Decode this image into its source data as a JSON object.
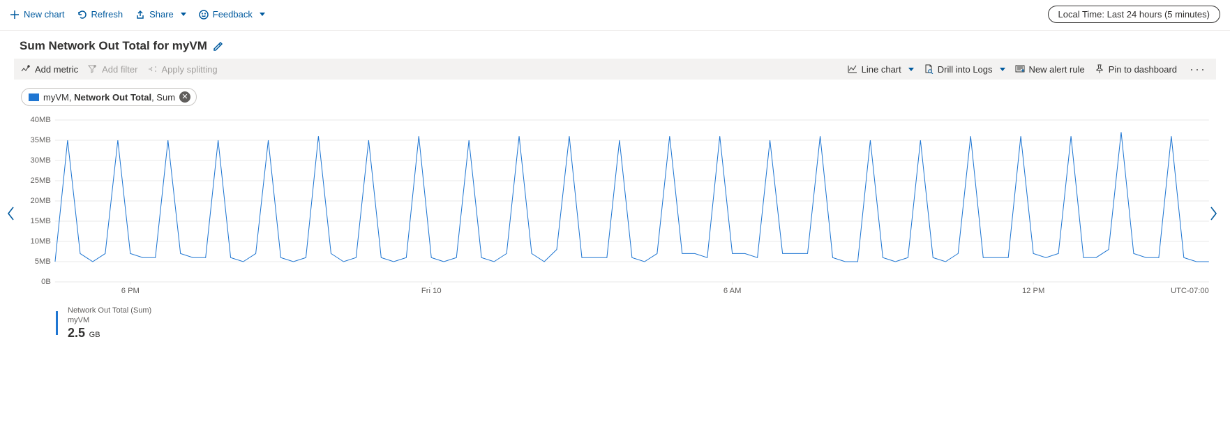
{
  "header": {
    "new_chart": "New chart",
    "refresh": "Refresh",
    "share": "Share",
    "feedback": "Feedback",
    "time_range": "Local Time: Last 24 hours (5 minutes)"
  },
  "title": "Sum Network Out Total for myVM",
  "sub_toolbar": {
    "add_metric": "Add metric",
    "add_filter": "Add filter",
    "apply_splitting": "Apply splitting",
    "line_chart": "Line chart",
    "drill_logs": "Drill into Logs",
    "new_alert": "New alert rule",
    "pin": "Pin to dashboard"
  },
  "chip": {
    "resource": "myVM",
    "metric": "Network Out Total",
    "agg": "Sum"
  },
  "legend": {
    "series_label": "Network Out Total (Sum)",
    "resource_label": "myVM",
    "value": "2.5",
    "unit": "GB"
  },
  "chart_data": {
    "type": "line",
    "title": "Sum Network Out Total for myVM",
    "ylabel": "",
    "xlabel": "",
    "ylim": [
      0,
      40
    ],
    "y_unit": "MB",
    "y_ticks": [
      0,
      5,
      10,
      15,
      20,
      25,
      30,
      35,
      40
    ],
    "y_tick_labels": [
      "0B",
      "5MB",
      "10MB",
      "15MB",
      "20MB",
      "25MB",
      "30MB",
      "35MB",
      "40MB"
    ],
    "x_ticks_idx": [
      6,
      30,
      54,
      78
    ],
    "x_tick_labels": [
      "6 PM",
      "Fri 10",
      "6 AM",
      "12 PM"
    ],
    "tz_label": "UTC-07:00",
    "series": [
      {
        "name": "Network Out Total (Sum)",
        "values": [
          5,
          35,
          7,
          5,
          7,
          35,
          7,
          6,
          6,
          35,
          7,
          6,
          6,
          35,
          6,
          5,
          7,
          35,
          6,
          5,
          6,
          36,
          7,
          5,
          6,
          35,
          6,
          5,
          6,
          36,
          6,
          5,
          6,
          35,
          6,
          5,
          7,
          36,
          7,
          5,
          8,
          36,
          6,
          6,
          6,
          35,
          6,
          5,
          7,
          36,
          7,
          7,
          6,
          36,
          7,
          7,
          6,
          35,
          7,
          7,
          7,
          36,
          6,
          5,
          5,
          35,
          6,
          5,
          6,
          35,
          6,
          5,
          7,
          36,
          6,
          6,
          6,
          36,
          7,
          6,
          7,
          36,
          6,
          6,
          8,
          37,
          7,
          6,
          6,
          36,
          6,
          5,
          5
        ]
      }
    ]
  }
}
